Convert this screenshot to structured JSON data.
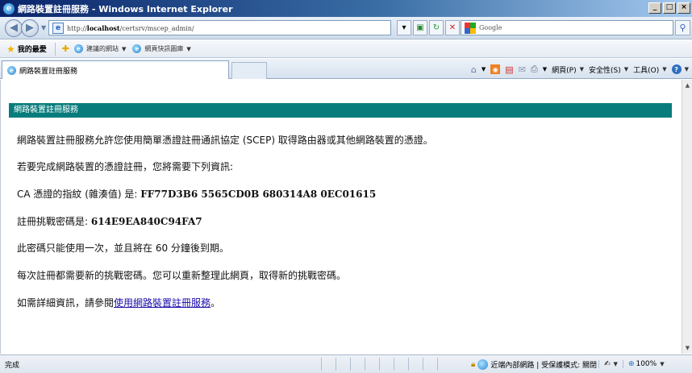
{
  "window": {
    "title": "網路裝置註冊服務 - Windows Internet Explorer",
    "controls": [
      "_",
      "□",
      "×"
    ]
  },
  "address": {
    "url_prefix": "http://",
    "url_host": "localhost",
    "url_path": "/certsrv/mscep_admin/",
    "search_placeholder": "Google"
  },
  "favorites": {
    "label": "我的最愛",
    "links": [
      {
        "label": "建議的網站"
      },
      {
        "label": "網頁快訊圖庫"
      }
    ]
  },
  "tab": {
    "title": "網路裝置註冊服務"
  },
  "commands": {
    "page": "網頁(P)",
    "safety": "安全性(S)",
    "tools": "工具(O)"
  },
  "content": {
    "banner": "網路裝置註冊服務",
    "intro": "網路裝置註冊服務允許您使用簡單憑證註冊通訊協定 (SCEP) 取得路由器或其他網路裝置的憑證。",
    "info_needed": "若要完成網路裝置的憑證註冊，您將需要下列資訊:",
    "thumbprint_label": "CA 憑證的指紋 (雜湊值) 是: ",
    "thumbprint_value": "FF77D3B6 5565CD0B 680314A8 0EC01615",
    "challenge_label": "註冊挑戰密碼是: ",
    "challenge_value": "614E9EA840C94FA7",
    "expiry_note": "此密碼只能使用一次，並且將在 60 分鐘後到期。",
    "refresh_note": "每次註冊都需要新的挑戰密碼。您可以重新整理此網頁，取得新的挑戰密碼。",
    "more_info_prefix": "如需詳細資訊，請參閱",
    "more_info_link": "使用網路裝置註冊服務",
    "more_info_suffix": "。"
  },
  "status": {
    "text": "完成",
    "zone": "近端內部網路 | 受保護模式: 關閉",
    "zoom": "100%"
  },
  "colors": {
    "banner": "#087c7c",
    "title_bar": "#0a246a",
    "link": "#1a0dab"
  },
  "icons": [
    "ie-logo-icon",
    "back-icon",
    "forward-icon",
    "page-icon",
    "refresh-icon",
    "stop-icon",
    "google-icon",
    "search-icon",
    "star-icon",
    "home-icon",
    "feeds-icon",
    "print-icon",
    "help-icon",
    "zone-icon",
    "zoom-icon"
  ]
}
